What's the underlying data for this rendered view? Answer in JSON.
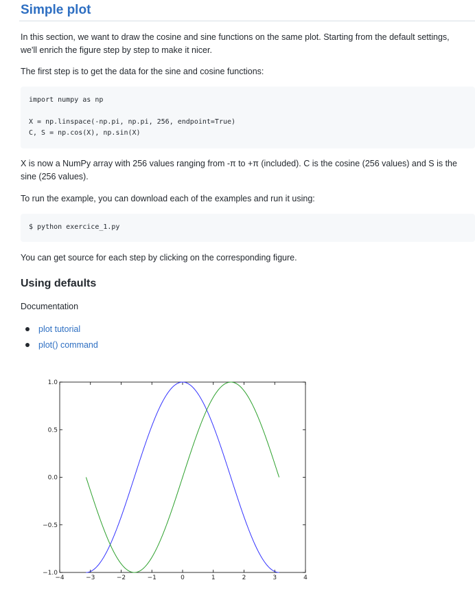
{
  "heading": "Simple plot",
  "intro": "In this section, we want to draw the cosine and sine functions on the same plot. Starting from the default settings, we'll enrich the figure step by step to make it nicer.",
  "step_intro": "The first step is to get the data for the sine and cosine functions:",
  "code1": {
    "lines": [
      "import numpy as np",
      "X = np.linspace(-np.pi, np.pi, 256, endpoint=True)",
      "C, S = np.cos(X), np.sin(X)"
    ]
  },
  "array_desc": "X is now a NumPy array with 256 values ranging from -π to +π (included). C is the cosine (256 values) and S is the sine (256 values).",
  "run_intro": "To run the example, you can download each of the examples and run it using:",
  "code2": {
    "line": "$ python exercice_1.py"
  },
  "source_note": "You can get source for each step by clicking on the corresponding figure.",
  "section": {
    "title": "Using defaults",
    "doc_label": "Documentation",
    "links": [
      "plot tutorial",
      "plot() command"
    ]
  },
  "chart_data": {
    "type": "line",
    "title": "",
    "xlabel": "",
    "ylabel": "",
    "xlim": [
      -4,
      4
    ],
    "ylim": [
      -1.0,
      1.0
    ],
    "x_ticks": [
      -4,
      -3,
      -2,
      -1,
      0,
      1,
      2,
      3,
      4
    ],
    "y_ticks": [
      1.0,
      0.5,
      0.0,
      -0.5,
      -1.0
    ],
    "x_tick_labels": [
      "−4",
      "−3",
      "−2",
      "−1",
      "0",
      "1",
      "2",
      "3",
      "4"
    ],
    "y_tick_labels": [
      "1.0",
      "0.5",
      "0.0",
      "−0.5",
      "−1.0"
    ],
    "grid": false,
    "x_range": [
      -3.14159,
      3.14159
    ],
    "samples": 256,
    "series": [
      {
        "function": "cos",
        "color": "#3333ff"
      },
      {
        "function": "sin",
        "color": "#2ca02c"
      }
    ]
  }
}
